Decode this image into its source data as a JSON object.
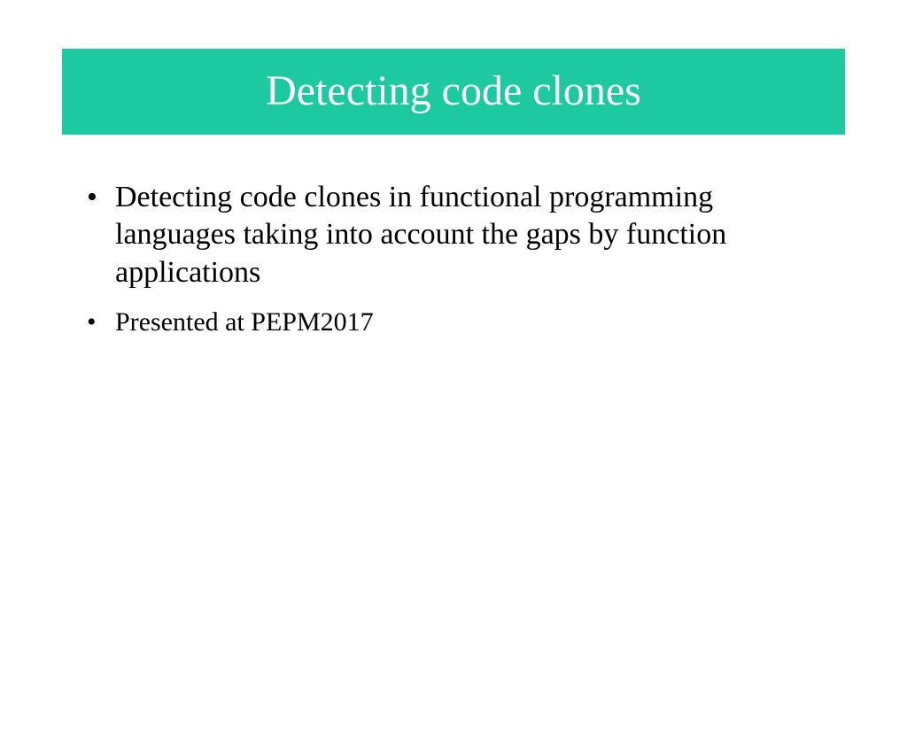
{
  "slide": {
    "title": "Detecting code clones",
    "bullets": [
      {
        "text": "Detecting code clones in functional programming languages taking into account the gaps by function applications",
        "size": "large"
      },
      {
        "text": "Presented at PEPM2017",
        "size": "medium"
      }
    ]
  },
  "colors": {
    "title_bg": "#1dc9a0",
    "title_fg": "#ffffff",
    "body_text": "#000000"
  }
}
